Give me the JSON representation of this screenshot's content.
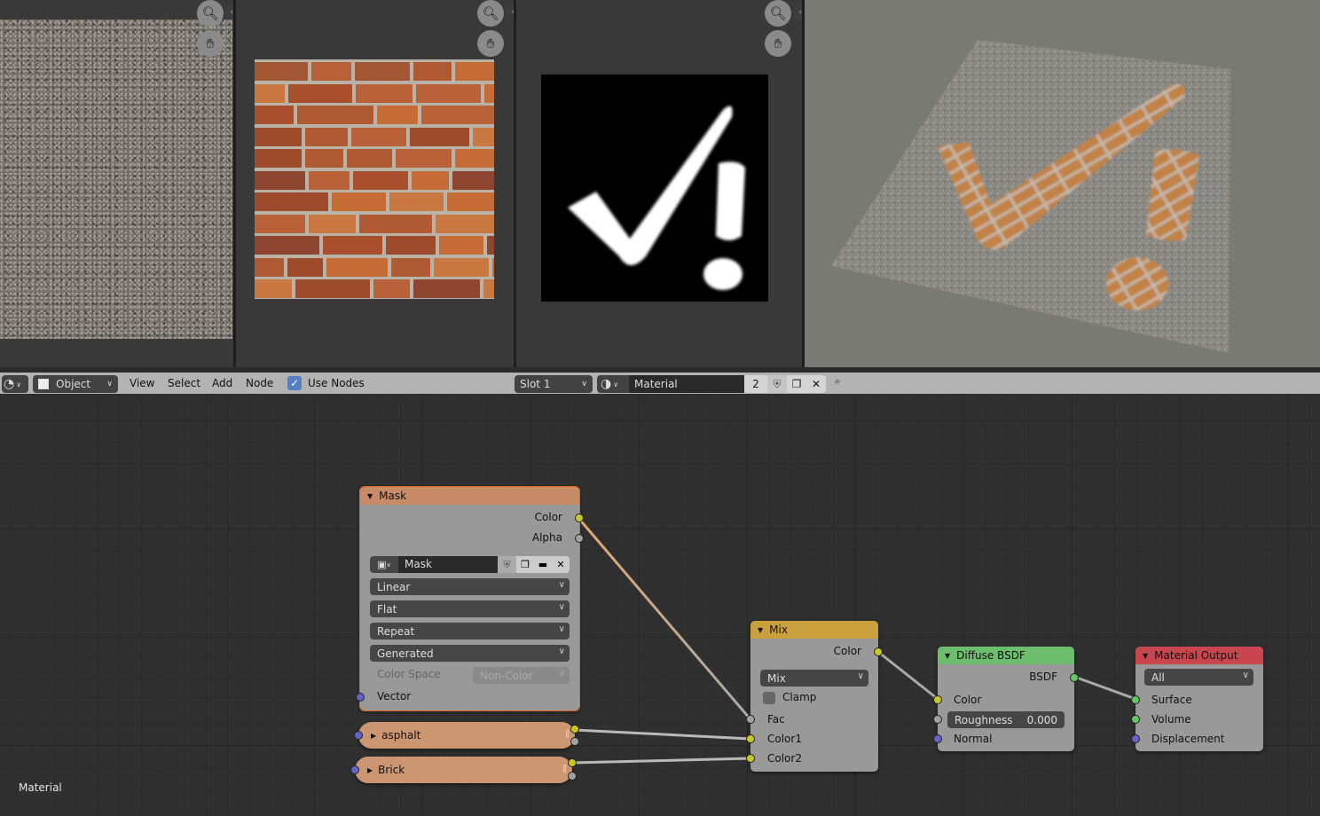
{
  "image_editors": [
    {
      "name": "asphalt",
      "texture": "asphalt"
    },
    {
      "name": "brick",
      "texture": "brick"
    },
    {
      "name": "mask",
      "texture": "checkmark-exclamation-mask"
    }
  ],
  "icons": {
    "zoom": "zoom-in-icon",
    "pan": "hand-pan-icon",
    "split": "split-arrows-icon"
  },
  "viewport": {
    "description": "3D preview of asphalt plane with brick checkmark and exclamation mask"
  },
  "toolbar": {
    "editor_type_icon": "node-editor-icon",
    "mode_label": "Object",
    "menus": [
      "View",
      "Select",
      "Add",
      "Node"
    ],
    "use_nodes_label": "Use Nodes",
    "use_nodes_checked": true,
    "slot_label": "Slot 1",
    "material_name": "Material",
    "user_count": "2"
  },
  "node_tree_label": "Material",
  "nodes": {
    "mask": {
      "title": "Mask",
      "outputs": [
        "Color",
        "Alpha"
      ],
      "image_name": "Mask",
      "interpolation": "Linear",
      "projection": "Flat",
      "extension": "Repeat",
      "source": "Generated",
      "color_space_label": "Color Space",
      "color_space_value": "Non-Color",
      "input": "Vector"
    },
    "asphalt": {
      "title": "asphalt"
    },
    "brick": {
      "title": "Brick"
    },
    "mix": {
      "title": "Mix",
      "output": "Color",
      "blend_type": "Mix",
      "clamp_label": "Clamp",
      "clamp_checked": false,
      "inputs": [
        "Fac",
        "Color1",
        "Color2"
      ]
    },
    "diffuse": {
      "title": "Diffuse BSDF",
      "output": "BSDF",
      "input_color": "Color",
      "roughness_label": "Roughness",
      "roughness_value": "0.000",
      "input_normal": "Normal"
    },
    "output": {
      "title": "Material Output",
      "target": "All",
      "inputs": [
        "Surface",
        "Volume",
        "Displacement"
      ]
    }
  },
  "colors": {
    "image_texture_header": "#c98a68",
    "mix_header": "#c9a03b",
    "shader_header": "#6cbe6c",
    "output_header": "#c9464e",
    "socket_color": "#c7c729",
    "socket_shader": "#63c763",
    "socket_vector": "#6363c7",
    "socket_float": "#a1a1a1"
  }
}
